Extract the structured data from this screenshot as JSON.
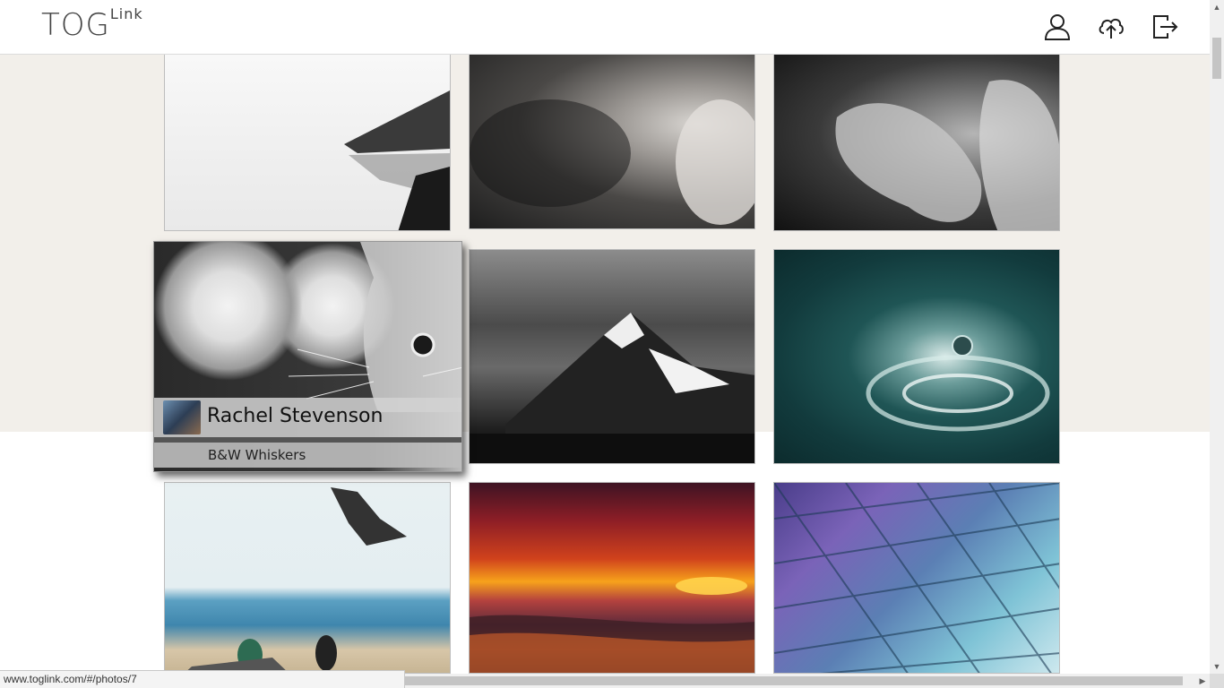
{
  "header": {
    "logo_main": "TOG",
    "logo_sup": "Link",
    "icons": [
      "user-icon",
      "cloud-upload-icon",
      "logout-icon"
    ]
  },
  "gallery": {
    "hover_card": {
      "author": "Rachel Stevenson",
      "title": "B&W Whiskers"
    }
  },
  "status_bar": {
    "url": "www.toglink.com/#/photos/7"
  }
}
